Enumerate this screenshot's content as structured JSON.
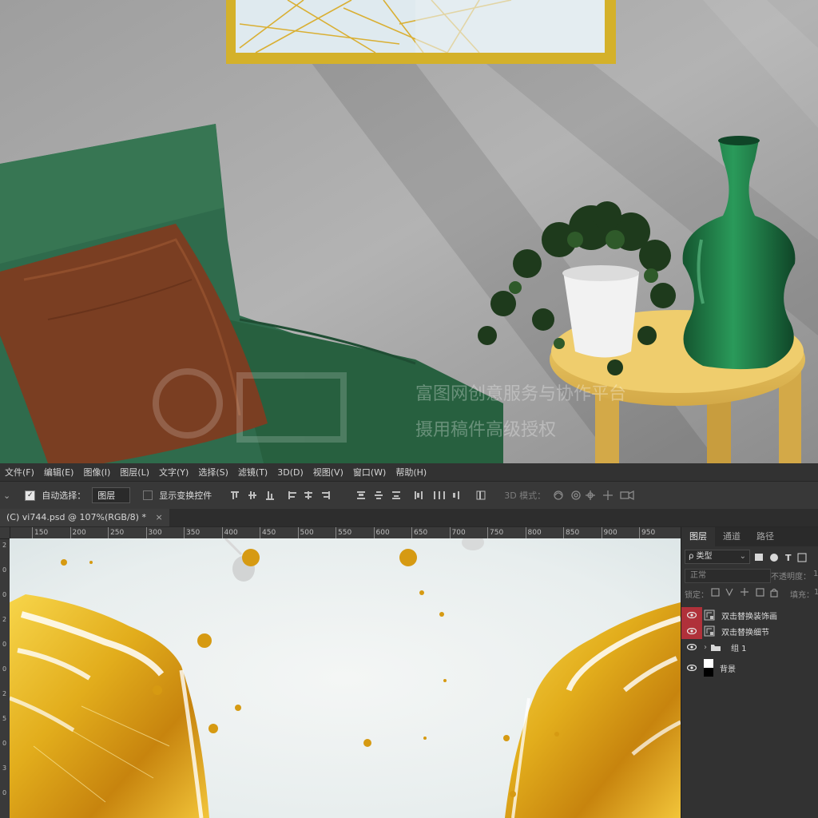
{
  "menu": [
    "文件(F)",
    "编辑(E)",
    "图像(I)",
    "图层(L)",
    "文字(Y)",
    "选择(S)",
    "滤镜(T)",
    "3D(D)",
    "视图(V)",
    "窗口(W)",
    "帮助(H)"
  ],
  "options": {
    "auto_select_label": "自动选择：",
    "auto_select_value": "图层",
    "show_transform_label": "显示变换控件",
    "mode_3d_label": "3D 模式："
  },
  "document_tab": "(C) vi744.psd @ 107%(RGB/8) *",
  "ruler": {
    "h_ticks": [
      "150",
      "200",
      "250",
      "300",
      "350",
      "400",
      "450",
      "500",
      "550",
      "600",
      "650",
      "700",
      "750",
      "800",
      "850",
      "900",
      "950"
    ],
    "v_ticks": [
      "2",
      "0",
      "0",
      "2",
      "0",
      "0",
      "2",
      "5",
      "0",
      "3",
      "0"
    ]
  },
  "watermark": {
    "line1": "富图网创意服务与协作平台",
    "line2": "摄用稿件高级授权"
  },
  "layers_panel": {
    "tabs": [
      "图层",
      "通道",
      "路径"
    ],
    "filter_label": "ρ 类型",
    "blend_mode": "正常",
    "opacity_label": "不透明度：",
    "opacity_value": "1",
    "lock_label": "锁定：",
    "fill_label": "填充：",
    "fill_value": "1",
    "layers": [
      {
        "name": "双击替换装饰画",
        "kind": "smart",
        "eye_highlight": true
      },
      {
        "name": "双击替换细节",
        "kind": "smart",
        "eye_highlight": true
      },
      {
        "name": "组 1",
        "kind": "group",
        "eye_highlight": false
      },
      {
        "name": "背景",
        "kind": "background",
        "eye_highlight": false
      }
    ]
  },
  "colors": {
    "accent_eye": "#b0313a",
    "frame_gold": "#d4b12a",
    "sofa_green": "#2f6b4c",
    "pillow_brown": "#7a3e22",
    "table_yellow": "#e3be5a",
    "vase_green": "#1f7a46",
    "gold_leaf": "#e2ad1c"
  }
}
